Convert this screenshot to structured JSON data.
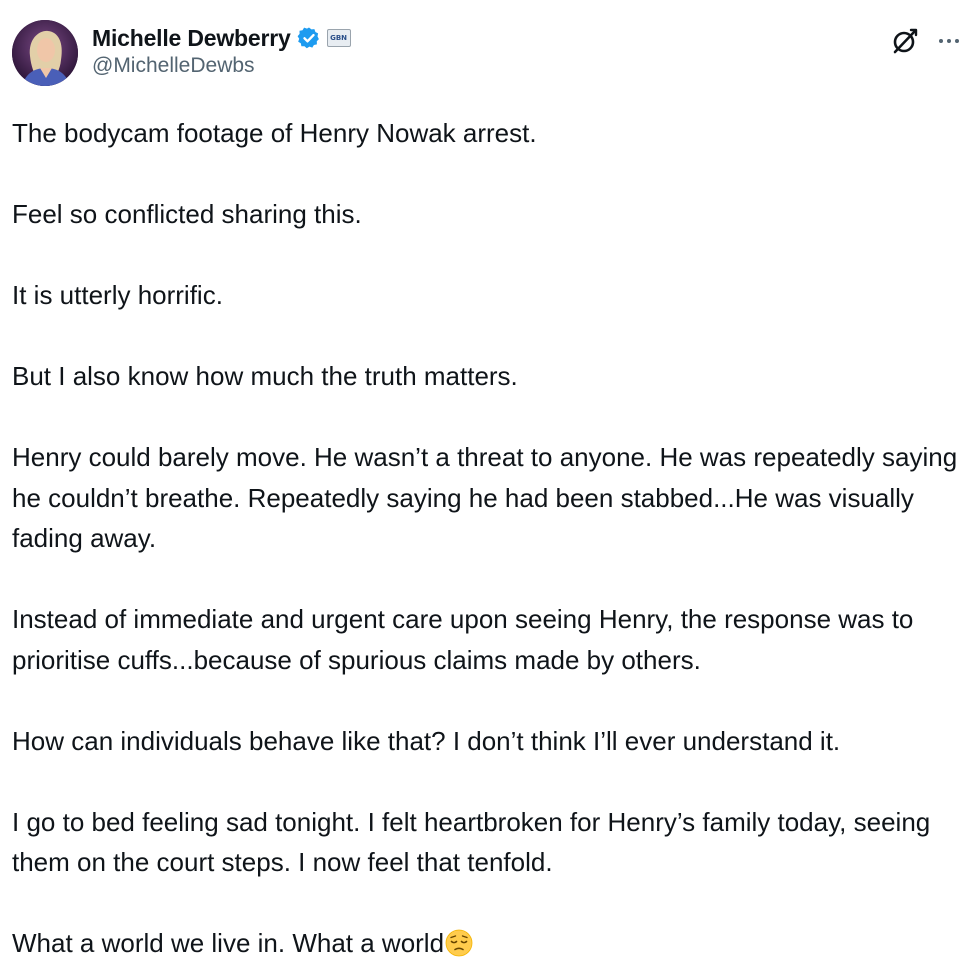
{
  "author": {
    "display_name": "Michelle Dewberry",
    "handle": "@MichelleDewbs",
    "verified": true,
    "affiliate_badge_text": "GBN",
    "accent_color": "#1d9bf0"
  },
  "actions": {
    "grok_icon": "grok-icon",
    "more_icon": "more-options-icon"
  },
  "tweet": {
    "paragraphs": [
      "The bodycam footage of Henry Nowak arrest.",
      "Feel so conflicted sharing this.",
      "It is utterly horrific.",
      "But I also know how much the truth matters.",
      "Henry could barely move. He wasn’t a threat to anyone. He was repeatedly saying he couldn’t breathe. Repeatedly saying he had been stabbed...He was visually fading away.",
      "Instead of immediate and urgent care upon seeing Henry, the response was to prioritise cuffs...because of spurious claims made by others.",
      "How can individuals behave like that? I don’t think I’ll ever understand it.",
      "I go to bed feeling sad tonight. I felt heartbroken for Henry’s family today, seeing them on the court steps. I now feel that tenfold.",
      "What a world we live in. What a world"
    ],
    "trailing_emoji": "pensive-face-emoji"
  }
}
